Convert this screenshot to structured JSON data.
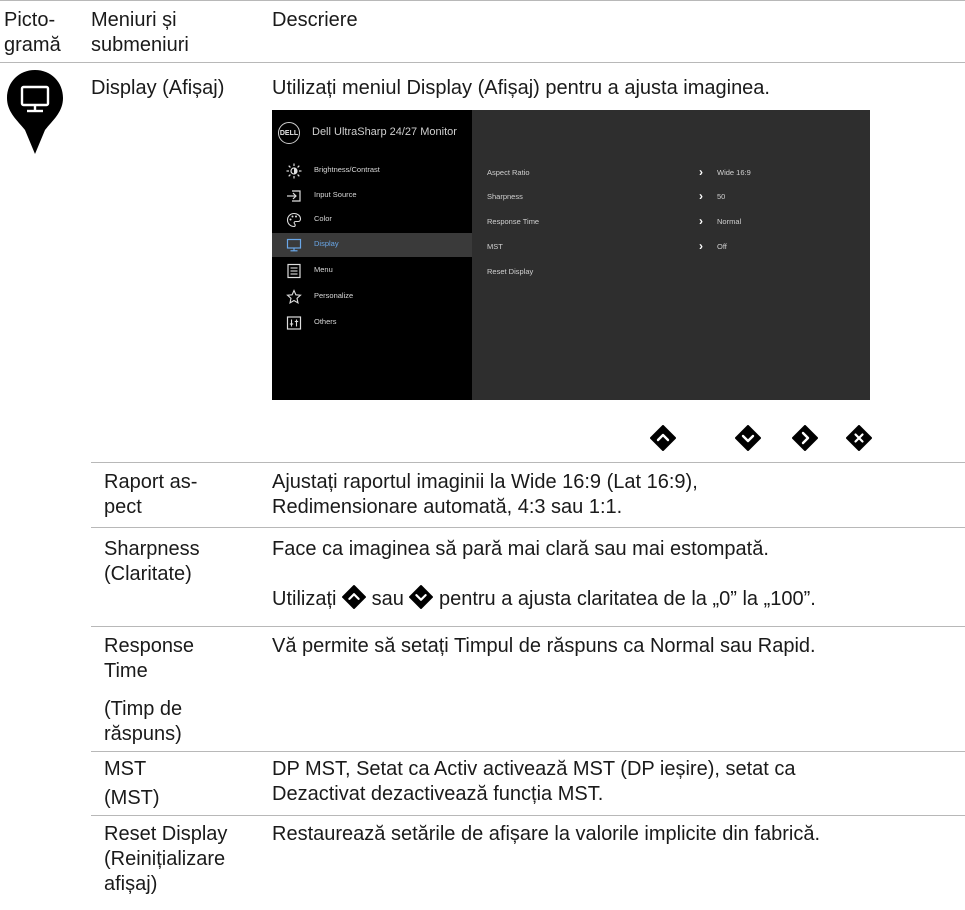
{
  "header": {
    "col1": "Picto-\ngramă",
    "col2": "Meniuri și\nsubmeniuri",
    "col3": "Descriere"
  },
  "main_row": {
    "icon": "monitor-pin-icon",
    "menu": "Display (Afișaj)",
    "intro": "Utilizați meniul Display (Afișaj) pentru a ajusta imaginea."
  },
  "osd": {
    "logo": "DELL",
    "title": "Dell UltraSharp 24/27 Monitor",
    "menu_items": [
      {
        "label": "Brightness/Contrast",
        "icon": "brightness-icon"
      },
      {
        "label": "Input Source",
        "icon": "input-source-icon"
      },
      {
        "label": "Color",
        "icon": "palette-icon"
      },
      {
        "label": "Display",
        "icon": "display-icon",
        "active": true
      },
      {
        "label": "Menu",
        "icon": "menu-list-icon"
      },
      {
        "label": "Personalize",
        "icon": "star-icon"
      },
      {
        "label": "Others",
        "icon": "others-icon"
      }
    ],
    "settings": [
      {
        "name": "Aspect Ratio",
        "value": "Wide 16:9",
        "arrow": true
      },
      {
        "name": "Sharpness",
        "value": "50",
        "arrow": true
      },
      {
        "name": "Response Time",
        "value": "Normal",
        "arrow": true
      },
      {
        "name": "MST",
        "value": "Off",
        "arrow": true
      },
      {
        "name": "Reset Display",
        "value": "",
        "arrow": false
      }
    ],
    "accent_color": "#6aa7e8"
  },
  "nav_buttons": [
    "up-button-icon",
    "down-button-icon",
    "right-button-icon",
    "close-button-icon"
  ],
  "rows": [
    {
      "name": "Raport as-\npect",
      "desc": "Ajustați raportul imaginii la Wide 16:9 (Lat 16:9),\nRedimensionare automată, 4:3 sau 1:1."
    },
    {
      "name": "Sharpness\n(Claritate)",
      "desc": "Face ca imaginea să pară mai clară sau mai estompată.",
      "desc2_a": "Utilizați",
      "desc2_b": "sau",
      "desc2_c": "pentru a ajusta claritatea de la „0” la „100”."
    },
    {
      "name": "Response\nTime",
      "name2": "(Timp de\nrăspuns)",
      "desc": "Vă permite să setați Timpul de răspuns ca Normal sau Rapid."
    },
    {
      "name": "MST",
      "name2": "(MST)",
      "desc": "DP MST, Setat ca Activ activează MST (DP ieșire), setat ca\nDezactivat dezactivează funcția MST."
    },
    {
      "name": "Reset Display\n(Reinițializare\nafișaj)",
      "desc": "Restaurează setările de afișare la valorile implicite din fabrică."
    }
  ],
  "colors": {
    "rule": "#b8b8b8",
    "icon": "#000000"
  }
}
